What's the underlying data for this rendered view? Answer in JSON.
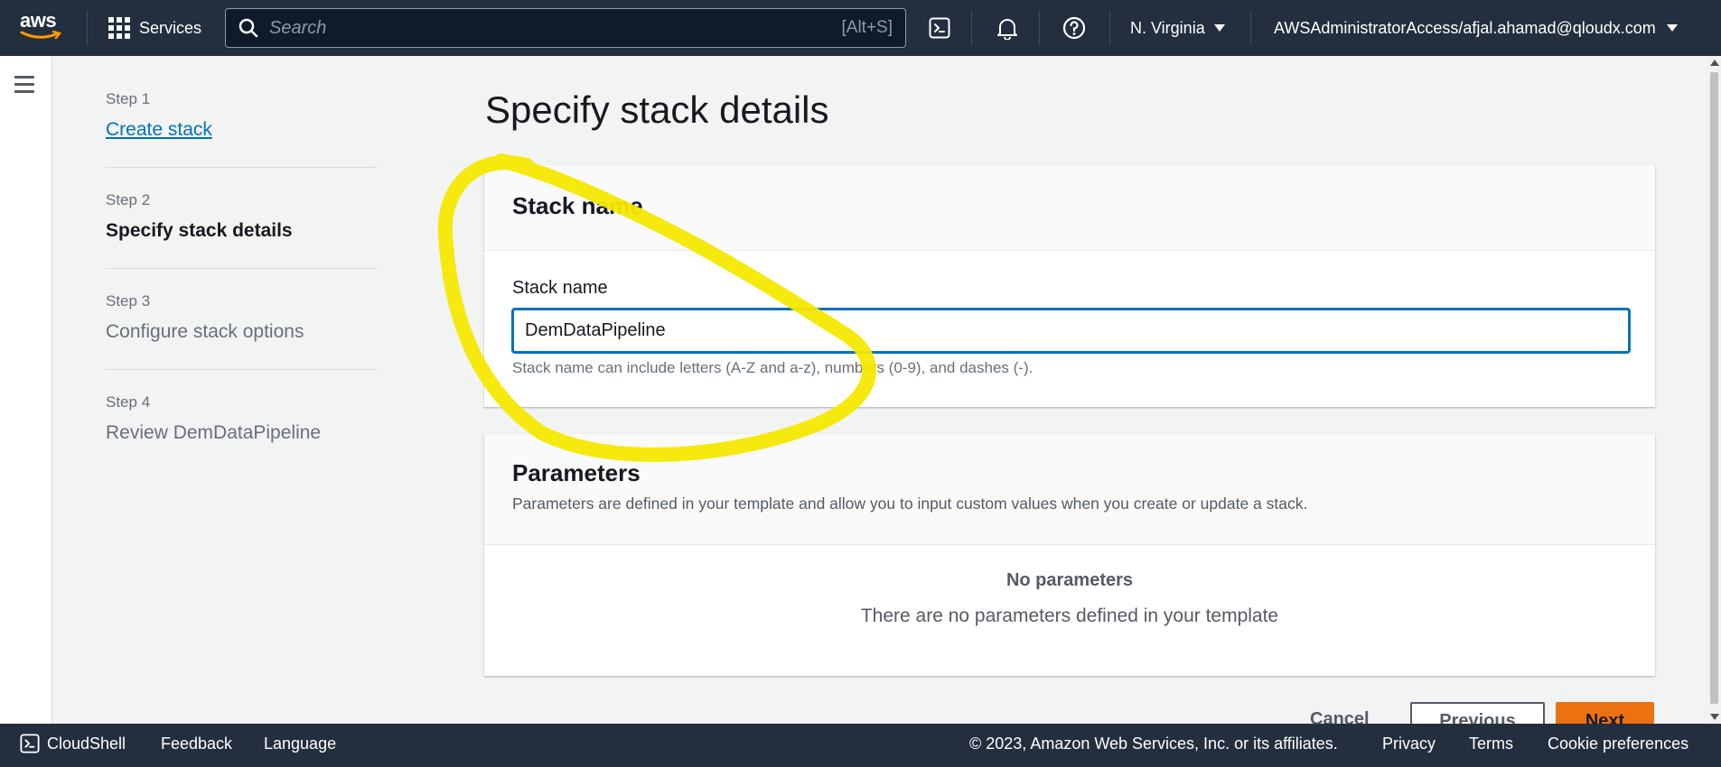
{
  "topnav": {
    "logo_text": "aws",
    "services_label": "Services",
    "search_placeholder": "Search",
    "search_shortcut": "[Alt+S]",
    "region_label": "N. Virginia",
    "account_label": "AWSAdministratorAccess/afjal.ahamad@qloudx.com"
  },
  "steps": [
    {
      "number": "Step 1",
      "label": "Create stack"
    },
    {
      "number": "Step 2",
      "label": "Specify stack details"
    },
    {
      "number": "Step 3",
      "label": "Configure stack options"
    },
    {
      "number": "Step 4",
      "label": "Review DemDataPipeline"
    }
  ],
  "page": {
    "title": "Specify stack details"
  },
  "stack_name_panel": {
    "title": "Stack name",
    "field_label": "Stack name",
    "field_value": "DemDataPipeline",
    "hint": "Stack name can include letters (A-Z and a-z), numbers (0-9), and dashes (-)."
  },
  "parameters_panel": {
    "title": "Parameters",
    "description": "Parameters are defined in your template and allow you to input custom values when you create or update a stack.",
    "empty_title": "No parameters",
    "empty_text": "There are no parameters defined in your template"
  },
  "actions": {
    "cancel": "Cancel",
    "previous": "Previous",
    "next": "Next"
  },
  "footer": {
    "cloudshell": "CloudShell",
    "feedback": "Feedback",
    "language": "Language",
    "copyright": "© 2023, Amazon Web Services, Inc. or its affiliates.",
    "privacy": "Privacy",
    "terms": "Terms",
    "cookie_preferences": "Cookie preferences"
  },
  "colors": {
    "nav_bg": "#232f3e",
    "link": "#0073bb",
    "primary_button": "#ec7211",
    "annotation": "#f5e800"
  }
}
